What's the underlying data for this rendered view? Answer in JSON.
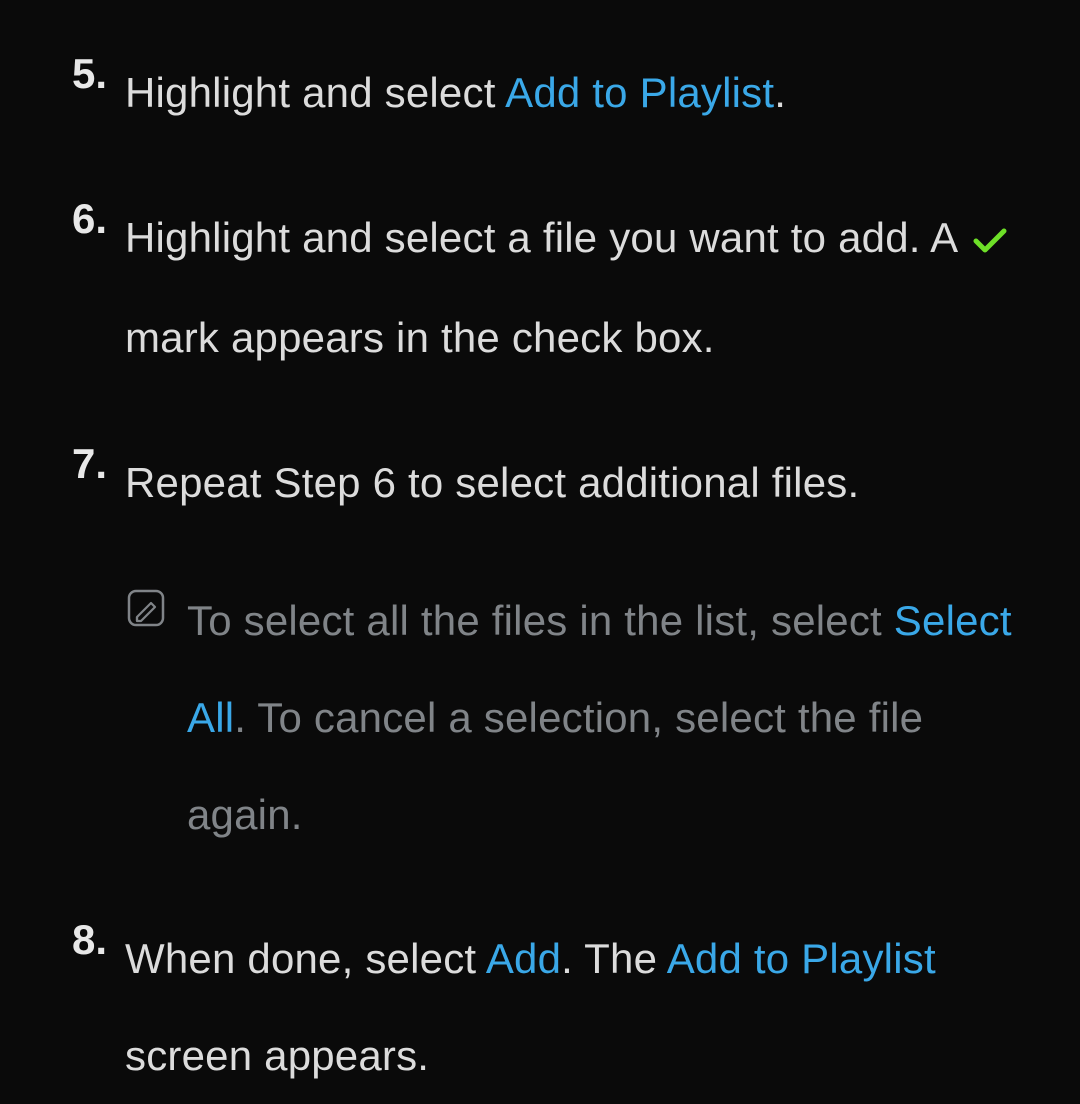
{
  "steps": [
    {
      "num": "5.",
      "parts": [
        {
          "t": "Highlight and select "
        },
        {
          "t": "Add to Playlist",
          "accent": true
        },
        {
          "t": "."
        }
      ]
    },
    {
      "num": "6.",
      "parts": [
        {
          "t": "Highlight and select a file you want to add. A "
        },
        {
          "icon": "check"
        },
        {
          "t": " mark appears in the check box."
        }
      ]
    },
    {
      "num": "7.",
      "parts": [
        {
          "t": "Repeat Step 6 to select additional files."
        }
      ],
      "note": {
        "parts": [
          {
            "t": "To select all the files in the list, select "
          },
          {
            "t": "Select All",
            "accent": true
          },
          {
            "t": ". To cancel a selection, select the file again."
          }
        ]
      }
    },
    {
      "num": "8.",
      "parts": [
        {
          "t": "When done, select "
        },
        {
          "t": "Add",
          "accent": true
        },
        {
          "t": ". The "
        },
        {
          "t": "Add to Playlist",
          "accent": true
        },
        {
          "t": " screen appears."
        }
      ]
    }
  ],
  "icons": {
    "check_color": "#6ee028",
    "note_stroke": "#808488"
  }
}
